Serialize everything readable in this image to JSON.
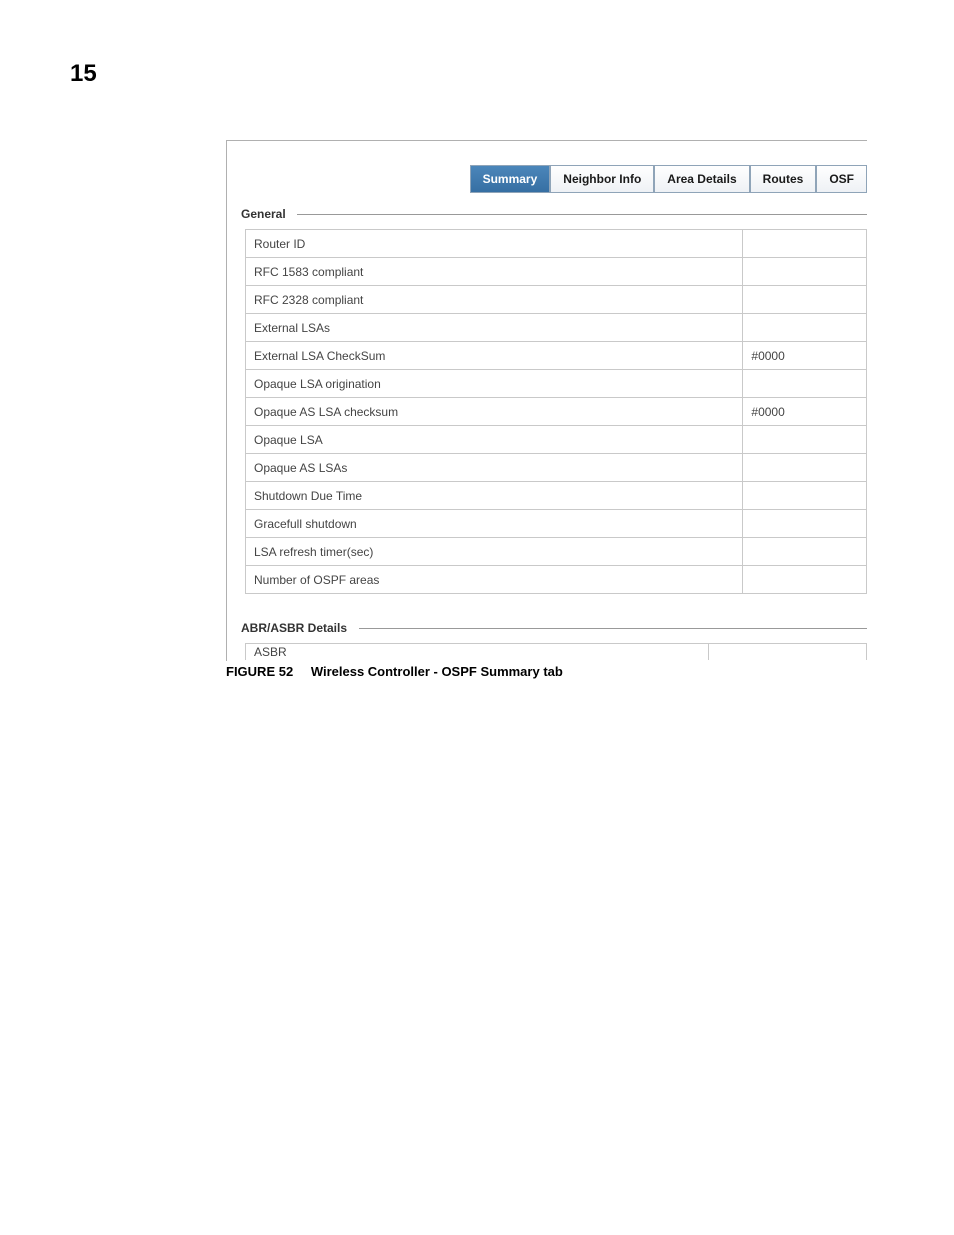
{
  "page_number": "15",
  "tabs": {
    "summary": "Summary",
    "neighbor": "Neighbor Info",
    "area": "Area Details",
    "routes": "Routes",
    "osf": "OSF"
  },
  "sections": {
    "general_label": "General",
    "abr_label": "ABR/ASBR Details"
  },
  "general_rows": [
    {
      "label": "Router ID",
      "value": ""
    },
    {
      "label": "RFC 1583 compliant",
      "value": ""
    },
    {
      "label": "RFC 2328 compliant",
      "value": ""
    },
    {
      "label": "External LSAs",
      "value": ""
    },
    {
      "label": "External LSA CheckSum",
      "value": "#0000"
    },
    {
      "label": "Opaque LSA origination",
      "value": ""
    },
    {
      "label": "Opaque AS LSA checksum",
      "value": "#0000"
    },
    {
      "label": "Opaque LSA",
      "value": ""
    },
    {
      "label": "Opaque AS LSAs",
      "value": ""
    },
    {
      "label": "Shutdown Due Time",
      "value": ""
    },
    {
      "label": "Gracefull shutdown",
      "value": ""
    },
    {
      "label": "LSA refresh timer(sec)",
      "value": ""
    },
    {
      "label": "Number of OSPF areas",
      "value": ""
    }
  ],
  "abr_rows": [
    {
      "label": "ASBR",
      "value": ""
    }
  ],
  "caption": {
    "figure": "FIGURE 52",
    "text": "Wireless Controller - OSPF Summary tab"
  }
}
